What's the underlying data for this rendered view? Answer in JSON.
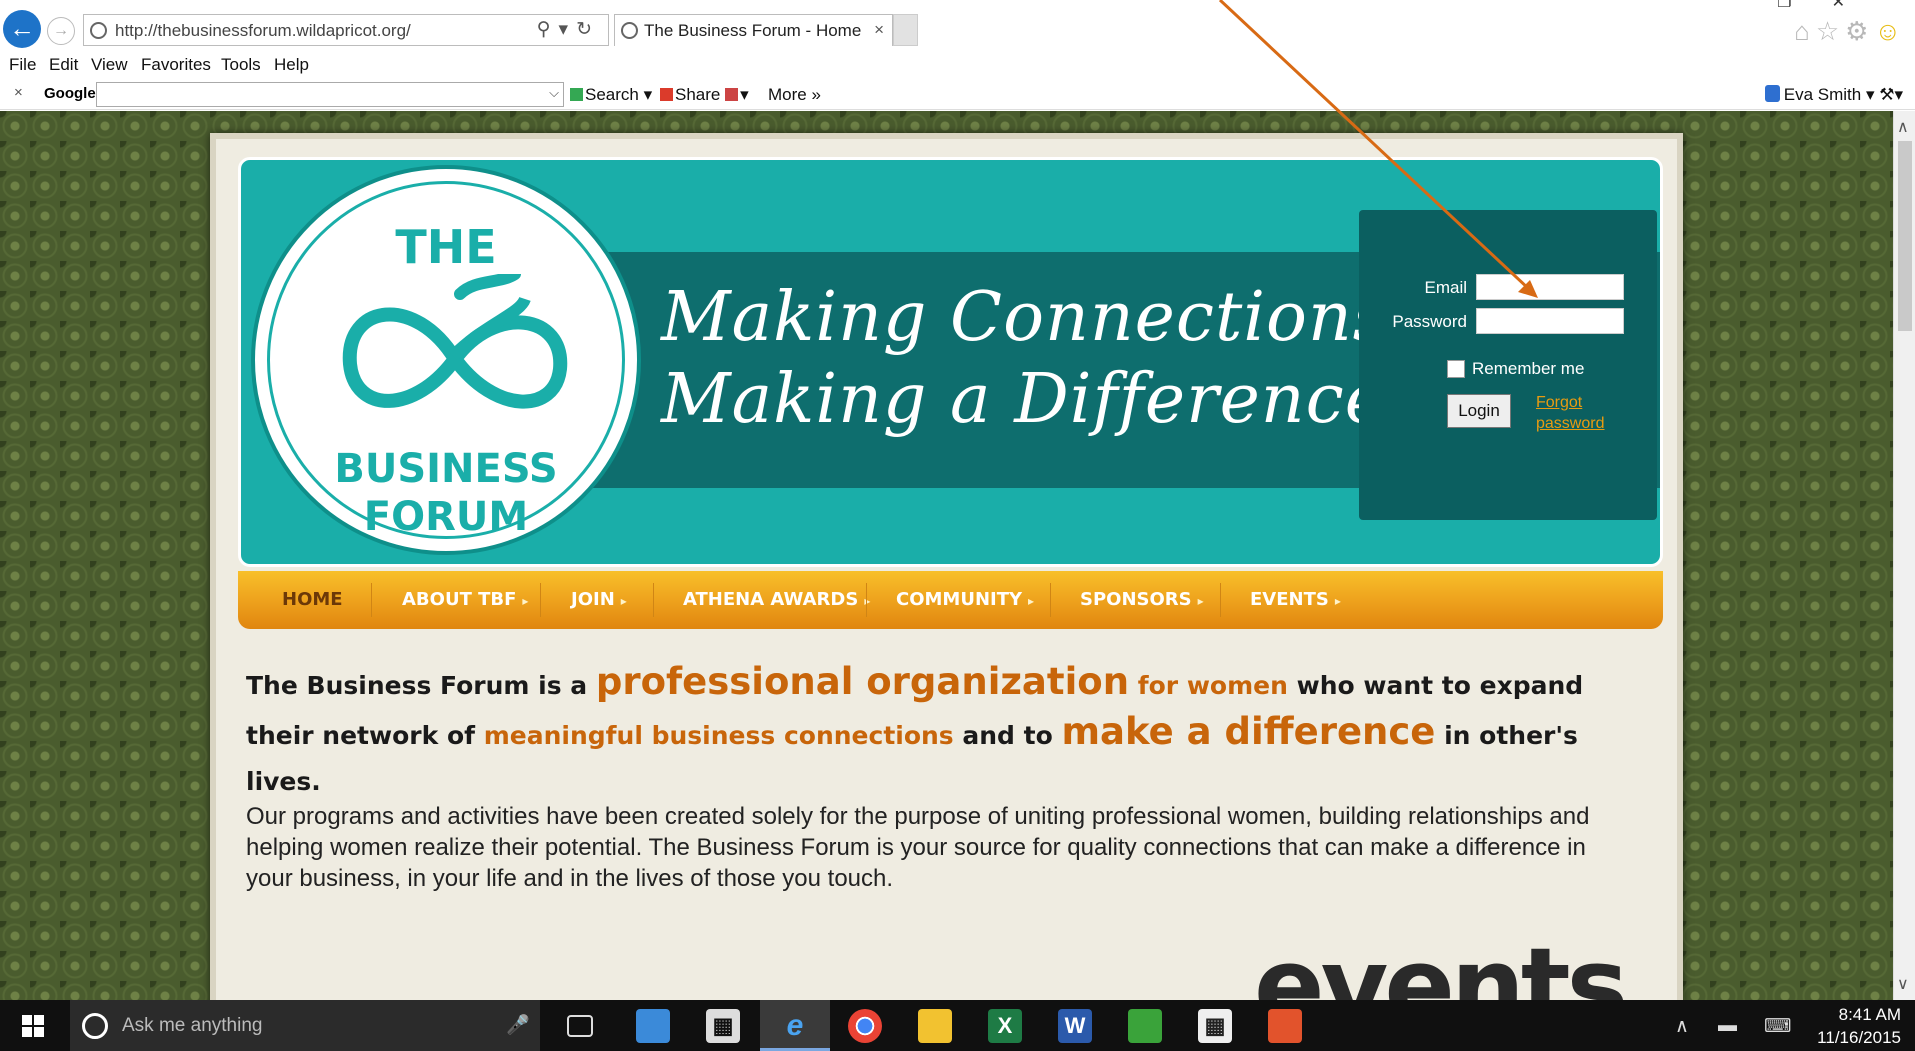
{
  "browser": {
    "url": "http://thebusinessforum.wildapricot.org/",
    "tab_title": "The Business Forum - Home",
    "tab_close": "×",
    "menu": [
      "File",
      "Edit",
      "View",
      "Favorites",
      "Tools",
      "Help"
    ]
  },
  "toolbar": {
    "close": "×",
    "google_label": "Google",
    "search_label": "Search",
    "share_label": "Share",
    "more_label": "More",
    "user_name": "Eva Smith"
  },
  "site": {
    "logo": {
      "the": "THE",
      "business": "BUSINESS",
      "forum": "FORUM"
    },
    "tagline_1": "Making Connections.",
    "tagline_2": "Making a Difference.",
    "login": {
      "email_label": "Email",
      "password_label": "Password",
      "remember_label": "Remember me",
      "login_button": "Login",
      "forgot_password": "Forgot password"
    },
    "nav": [
      "HOME",
      "ABOUT TBF",
      "JOIN",
      "ATHENA AWARDS",
      "COMMUNITY",
      "SPONSORS",
      "EVENTS"
    ],
    "intro": {
      "p1": "The Business Forum is a ",
      "h1": "professional organization",
      "h2": " for women",
      "p2": " who want to expand their network of ",
      "h3": "meaningful business connections",
      "p3": " and to ",
      "h4": "make a difference",
      "p4": " in other's lives."
    },
    "body": "Our programs and activities have been created solely for the purpose of uniting professional women, building relationships and helping women realize their potential. The Business Forum is your source for quality connections that can make a difference in your business, in your life and in the lives of those you touch.",
    "events_heading": "events"
  },
  "taskbar": {
    "search_placeholder": "Ask me anything",
    "time": "8:41 AM",
    "date": "11/16/2015"
  },
  "colors": {
    "teal": "#1aaea9",
    "dark_teal": "#0e6e6e",
    "orange": "#c8650a",
    "nav_orange": "#eda01c",
    "annotation_arrow": "#d86a14"
  }
}
